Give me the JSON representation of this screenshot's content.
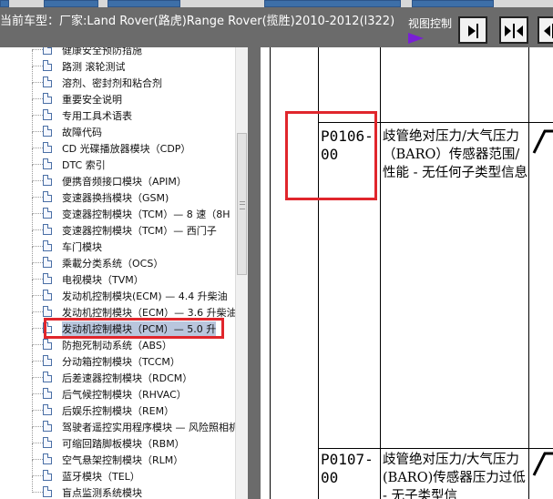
{
  "header": {
    "car_title": "当前车型：厂家:Land Rover(路虎)Range Rover(揽胜)2010-2012(l322)",
    "view_control_label": "视图控制",
    "buttons": [
      "view-right-button",
      "view-collapse-button",
      "view-expand-button"
    ]
  },
  "tree": {
    "items": [
      {
        "label": "健康安全预防措施"
      },
      {
        "label": "路测 滚轮测试"
      },
      {
        "label": "溶剂、密封剂和粘合剂"
      },
      {
        "label": "重要安全说明"
      },
      {
        "label": "专用工具术语表"
      },
      {
        "label": "故障代码"
      },
      {
        "label": "CD 光碟播放器模块（CDP）"
      },
      {
        "label": "DTC 索引"
      },
      {
        "label": "便携音频接口模块（APIM）"
      },
      {
        "label": "变速器换挡模块（GSM)"
      },
      {
        "label": "变速器控制模块（TCM）— 8 速（8H"
      },
      {
        "label": "变速器控制模块（TCM）— 西门子"
      },
      {
        "label": "车门模块"
      },
      {
        "label": "乘載分类系统（OCS）"
      },
      {
        "label": "电视模块（TVM）"
      },
      {
        "label": "发动机控制模块(ECM) — 4.4 升柴油"
      },
      {
        "label": "发动机控制模块（ECM）— 3.6 升柴油"
      },
      {
        "label": "发动机控制模块（PCM）— 5.0 升"
      },
      {
        "label": "防抱死制动系统（ABS）"
      },
      {
        "label": "分动箱控制模块（TCCM）"
      },
      {
        "label": "后差速器控制模块（RDCM）"
      },
      {
        "label": "后气候控制模块（RHVAC）"
      },
      {
        "label": "后娱乐控制模块（REM）"
      },
      {
        "label": "驾驶者遥控实用程序模块 — 风险照相机"
      },
      {
        "label": "可缩回踏脚板模块（RBM）"
      },
      {
        "label": "空气悬架控制模块（RLM）"
      },
      {
        "label": "蓝牙模块（TEL）"
      },
      {
        "label": "盲点监测系统模块"
      }
    ],
    "selected_index": 17
  },
  "content": {
    "rows": [
      {
        "code_line1": "P0106-",
        "code_line2": "00",
        "description": "歧管绝对压力/大气压力（BARO）传感器范围/性能 - 无任何子类型信息"
      },
      {
        "code_line1": "P0107-",
        "code_line2": "00",
        "description": "歧管绝对压力/大气压力(BARO)传感器压力过低 - 无子类型信"
      }
    ]
  },
  "colors": {
    "header_bg": "#6b6b6b",
    "highlight_red": "#e0262c",
    "selection_bg": "#b9c6dd",
    "arrow_purple": "#7a1fd6"
  }
}
